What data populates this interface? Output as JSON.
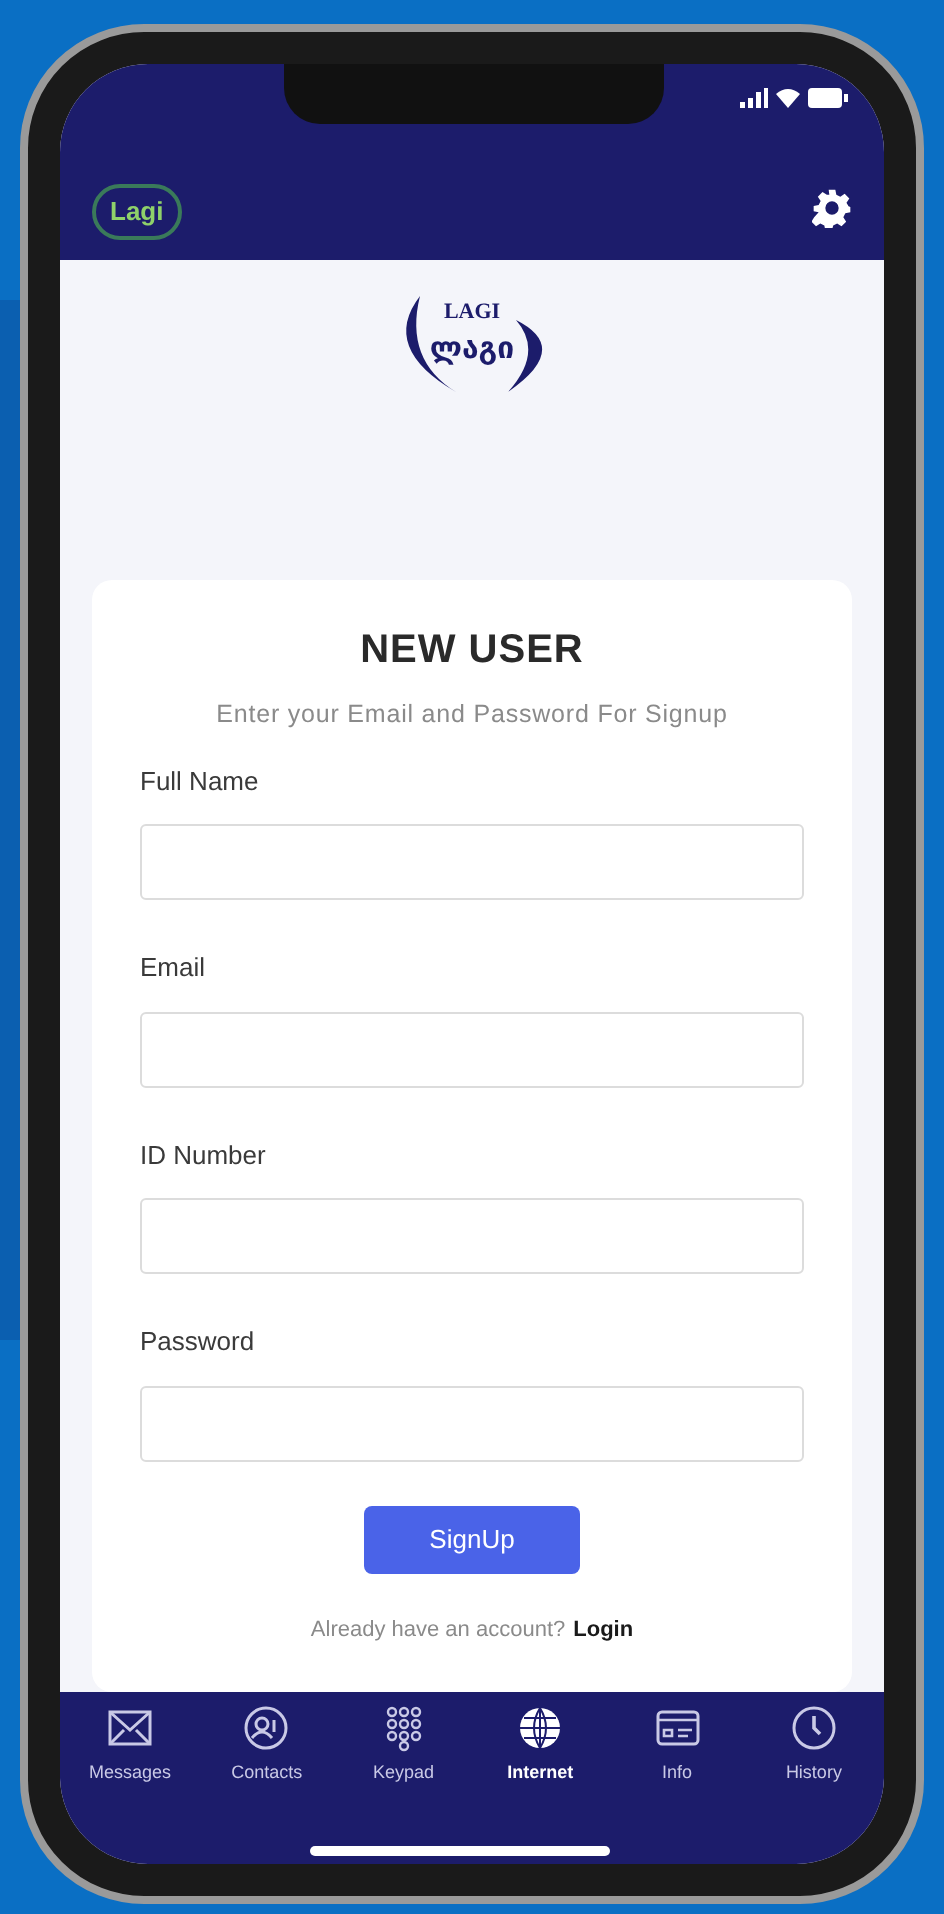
{
  "header": {
    "badge": "Lagi"
  },
  "logo": {
    "top": "LAGI",
    "bottom": "ლაგი"
  },
  "form": {
    "title": "NEW USER",
    "subtitle": "Enter your Email and Password For Signup",
    "fields": [
      {
        "label": "Full Name"
      },
      {
        "label": "Email"
      },
      {
        "label": "ID Number"
      },
      {
        "label": "Password"
      }
    ],
    "button": "SignUp",
    "prompt": "Already have an account?",
    "link": "Login"
  },
  "tabs": [
    {
      "label": "Messages",
      "kind": "mail",
      "selected": false
    },
    {
      "label": "Contacts",
      "kind": "contact",
      "selected": false
    },
    {
      "label": "Keypad",
      "kind": "keypad",
      "selected": false
    },
    {
      "label": "Internet",
      "kind": "globe",
      "selected": true
    },
    {
      "label": "Info",
      "kind": "card",
      "selected": false
    },
    {
      "label": "History",
      "kind": "clock",
      "selected": false
    }
  ]
}
